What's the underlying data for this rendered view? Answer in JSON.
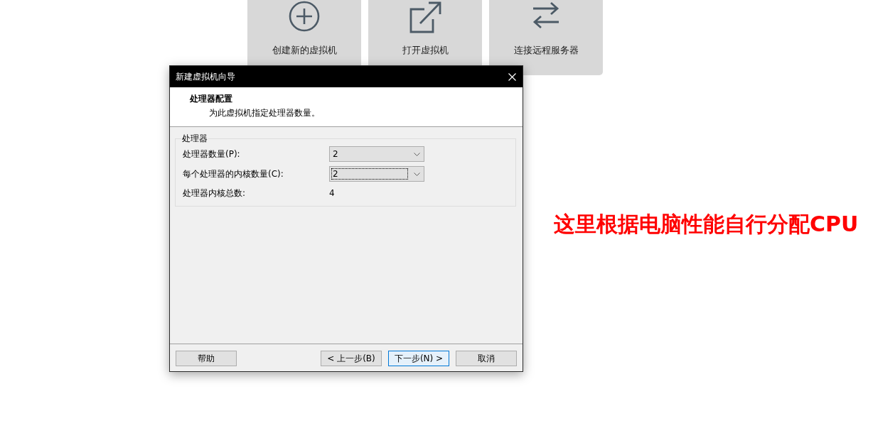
{
  "tiles": [
    {
      "label": "创建新的虚拟机"
    },
    {
      "label": "打开虚拟机"
    },
    {
      "label": "连接远程服务器"
    }
  ],
  "dialog": {
    "title": "新建虚拟机向导",
    "header": {
      "title": "处理器配置",
      "subtitle": "为此虚拟机指定处理器数量。"
    },
    "group": {
      "legend": "处理器",
      "rows": [
        {
          "kind": "dropdown",
          "label": "处理器数量(P):",
          "value": "2",
          "focused": false
        },
        {
          "kind": "dropdown",
          "label": "每个处理器的内核数量(C):",
          "value": "2",
          "focused": true
        },
        {
          "kind": "text",
          "label": "处理器内核总数:",
          "value": "4"
        }
      ]
    },
    "buttons": [
      {
        "label": "帮助",
        "default": false
      },
      {
        "label": "< 上一步(B)",
        "default": false
      },
      {
        "label": "下一步(N) >",
        "default": true
      },
      {
        "label": "取消",
        "default": false
      }
    ]
  },
  "annotation": {
    "text": "这里根据电脑性能自行分配CPU"
  }
}
